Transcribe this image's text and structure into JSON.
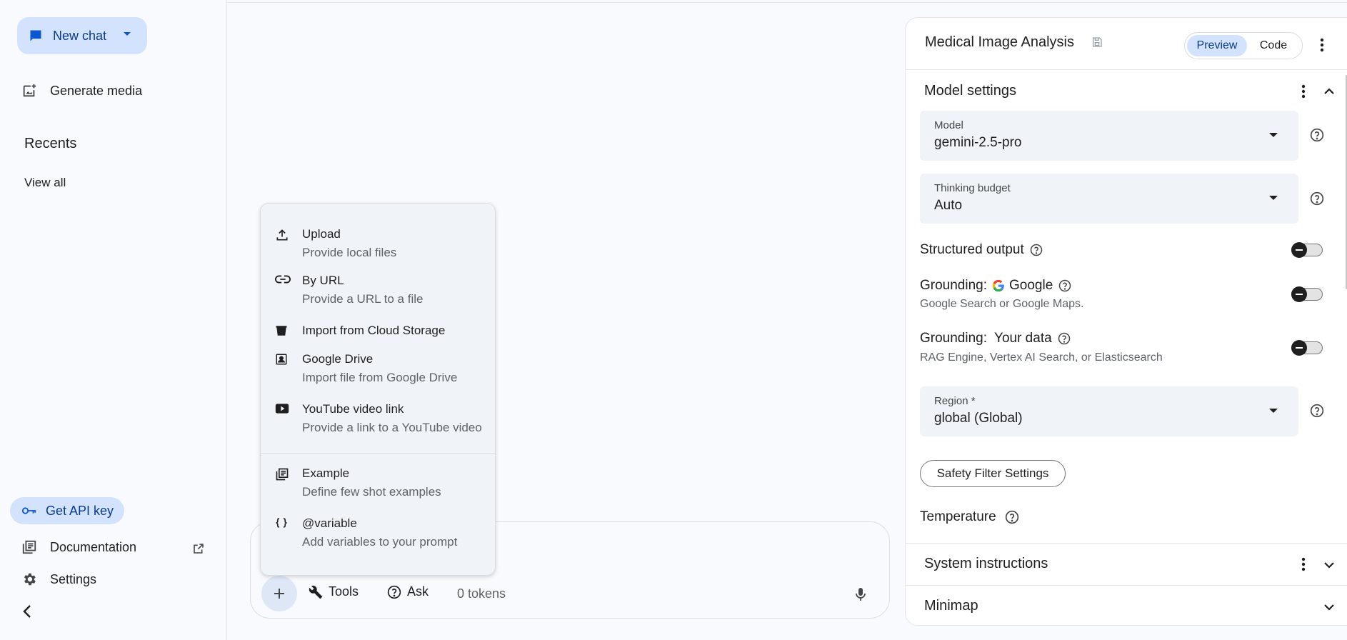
{
  "sidebar": {
    "new_chat_label": "New chat",
    "generate_media_label": "Generate media",
    "recents_label": "Recents",
    "view_all_label": "View all",
    "api_key_label": "Get API key",
    "documentation_label": "Documentation",
    "settings_label": "Settings"
  },
  "prompt": {
    "tools_label": "Tools",
    "ask_label": "Ask",
    "tokens_label": "0 tokens"
  },
  "menu": {
    "items": [
      {
        "title": "Upload",
        "subtitle": "Provide local files",
        "icon": "upload-icon"
      },
      {
        "title": "By URL",
        "subtitle": "Provide a URL to a file",
        "icon": "link-icon"
      },
      {
        "title": "Import from Cloud Storage",
        "subtitle": "",
        "icon": "bucket-icon"
      },
      {
        "title": "Google Drive",
        "subtitle": "Import file from Google Drive",
        "icon": "drive-icon"
      },
      {
        "title": "YouTube video link",
        "subtitle": "Provide a link to a YouTube video",
        "icon": "youtube-icon"
      },
      {
        "title": "Example",
        "subtitle": "Define few shot examples",
        "icon": "examples-icon"
      },
      {
        "title": "@variable",
        "subtitle": "Add variables to your prompt",
        "icon": "variable-icon"
      }
    ]
  },
  "panel": {
    "title": "Medical Image Analysis",
    "preview_label": "Preview",
    "code_label": "Code",
    "model_settings_title": "Model settings",
    "model_label": "Model",
    "model_value": "gemini-2.5-pro",
    "thinking_label": "Thinking budget",
    "thinking_value": "Auto",
    "structured_output_label": "Structured output",
    "grounding_google_prefix": "Grounding:",
    "grounding_google_name": "Google",
    "grounding_google_sub": "Google Search or Google Maps.",
    "grounding_data_prefix": "Grounding:",
    "grounding_data_name": "Your data",
    "grounding_data_sub": "RAG Engine, Vertex AI Search, or Elasticsearch",
    "region_label": "Region *",
    "region_value": "global (Global)",
    "safety_label": "Safety Filter Settings",
    "temperature_label": "Temperature",
    "system_instructions_title": "System instructions",
    "minimap_title": "Minimap"
  }
}
